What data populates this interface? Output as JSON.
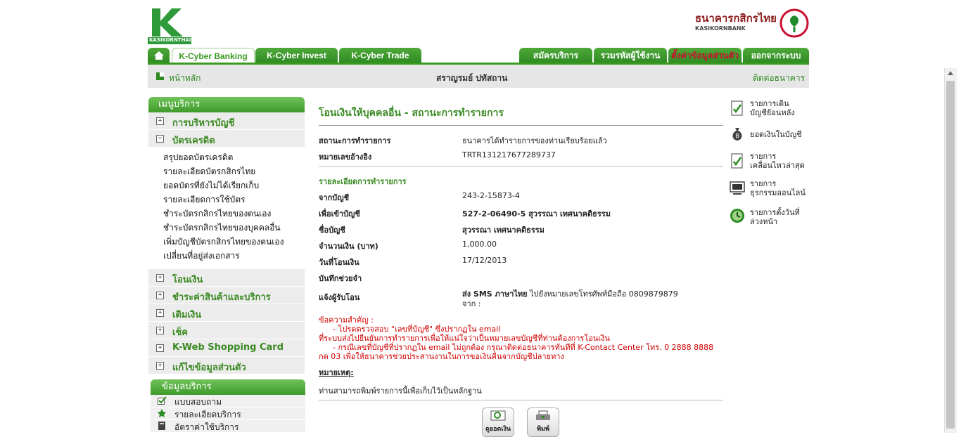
{
  "header": {
    "kasikornthai_logo_text": "KASIKORNTHAI",
    "bank_name_thai": "ธนาคารกสิกรไทย",
    "bank_name_en": "KASIKORNBANK"
  },
  "tabs": {
    "k_cyber_banking": "K-Cyber Banking",
    "k_cyber_invest": "K-Cyber Invest",
    "k_cyber_trade": "K-Cyber Trade",
    "apply_service": "สมัครบริการ",
    "combine_user": "รวมรหัสผู้ใช้งาน",
    "personal_settings": "ตั้งค่าข้อมูลส่วนตัว",
    "logout": "ออกจากระบบ"
  },
  "subbar": {
    "home": "หน้าหลัก",
    "user_name": "สราญรมย์ ปทัสถาน",
    "contact": "ติดต่อธนาคาร"
  },
  "menu": {
    "header": "เมนูบริการ",
    "account_management": "การบริหารบัญชี",
    "credit_card": "บัตรเครดิต",
    "credit_sub": [
      "สรุปยอดบัตรเครดิต",
      "รายละเอียดบัตรกสิกรไทย",
      "ยอดบัตรที่ยังไม่ได้เรียกเก็บ",
      "รายละเอียดการใช้บัตร",
      "ชำระบัตรกสิกรไทยของตนเอง",
      "ชำระบัตรกสิกรไทยของบุคคลอื่น",
      "เพิ่มบัญชีบัตรกสิกรไทยของตนเอง",
      "เปลี่ยนที่อยู่ส่งเอกสาร"
    ],
    "transfer": "โอนเงิน",
    "pay_bills": "ชำระค่าสินค้าและบริการ",
    "top_up": "เติมเงิน",
    "cheque": "เช็ค",
    "kweb_shopping": "K-Web Shopping Card",
    "edit_personal": "แก้ไขข้อมูลส่วนตัว",
    "service_info_header": "ข้อมูลบริการ",
    "survey": "แบบสอบถาม",
    "service_details": "รายละเอียดบริการ",
    "service_fees": "อัตราค่าใช้บริการ"
  },
  "main": {
    "title": "โอนเงินให้บุคคลอื่น - สถานะการทำรายการ",
    "status_label": "สถานะการทำรายการ",
    "status_value": "ธนาคารได้ทำรายการของท่านเรียบร้อยแล้ว",
    "ref_label": "หมายเลขอ้างอิง",
    "ref_value": "TRTR131217677289737",
    "details_header": "รายละเอียดการทำรายการ",
    "from_label": "จากบัญชี",
    "from_value": "243-2-15873-4",
    "to_label": "เพื่อเข้าบัญชี",
    "to_value": "527-2-06490-5 สุวรรณา เทศนาคดิธรรม",
    "account_name_label": "ชื่อบัญชี",
    "account_name_value": "สุวรรณา เทศนาคดิธรรม",
    "amount_label": "จำนวนเงิน (บาท)",
    "amount_value": "1,000.00",
    "date_label": "วันที่โอนเงิน",
    "date_value": "17/12/2013",
    "memo_label": "บันทึกช่วยจำ",
    "notify_label": "แจ้งผู้รับโอน",
    "notify_value_bold": "ส่ง SMS ภาษาไทย",
    "notify_value_rest": "ไปยังหมายเลขโทรศัพท์มือถือ 0809879879",
    "notify_from": "จาก :",
    "important_title": "ข้อความสำคัญ :",
    "important_line1": "- โปรดตรวจสอบ \"เลขที่บัญชี\" ซึ่งปรากฏใน email",
    "important_line2": "ที่ระบบส่งไปยืนยันการทำรายการเพื่อให้แน่ใจว่าเป็นหมายเลขบัญชีที่ท่านต้องการโอนเงิน",
    "important_line3": "- กรณีเลขที่บัญชีที่ปรากฏใน email ไม่ถูกต้อง กรุณาติดต่อธนาคารทันทีที่ K-Contact Center โทร. 0 2888 8888",
    "important_line4": "กด 03 เพื่อให้ธนาคารช่วยประสานงานในการขอเงินคืนจากบัญชีปลายทาง",
    "remark_title": "หมายเหตุ:",
    "remark_text": "ท่านสามารถพิมพ์รายการนี้เพื่อเก็บไว้เป็นหลักฐาน",
    "btn_check_balance": "ดูยอดเงิน",
    "btn_print": "พิมพ์"
  },
  "right": {
    "item1": [
      "รายการเดิน",
      "บัญชีย้อนหลัง"
    ],
    "item2": [
      "ยอดเงินในบัญชี"
    ],
    "item3": [
      "รายการ",
      "เคลื่อนไหวล่าสุด"
    ],
    "item4": [
      "รายการ",
      "ธุรกรรมออนไลน์"
    ],
    "item5": [
      "รายการตั้งวันที่",
      "ล่วงหน้า"
    ]
  },
  "colors": {
    "brand_green": "#3a9a1f",
    "alert_red": "#d10000",
    "tab_highlight_red": "#c8102e"
  }
}
